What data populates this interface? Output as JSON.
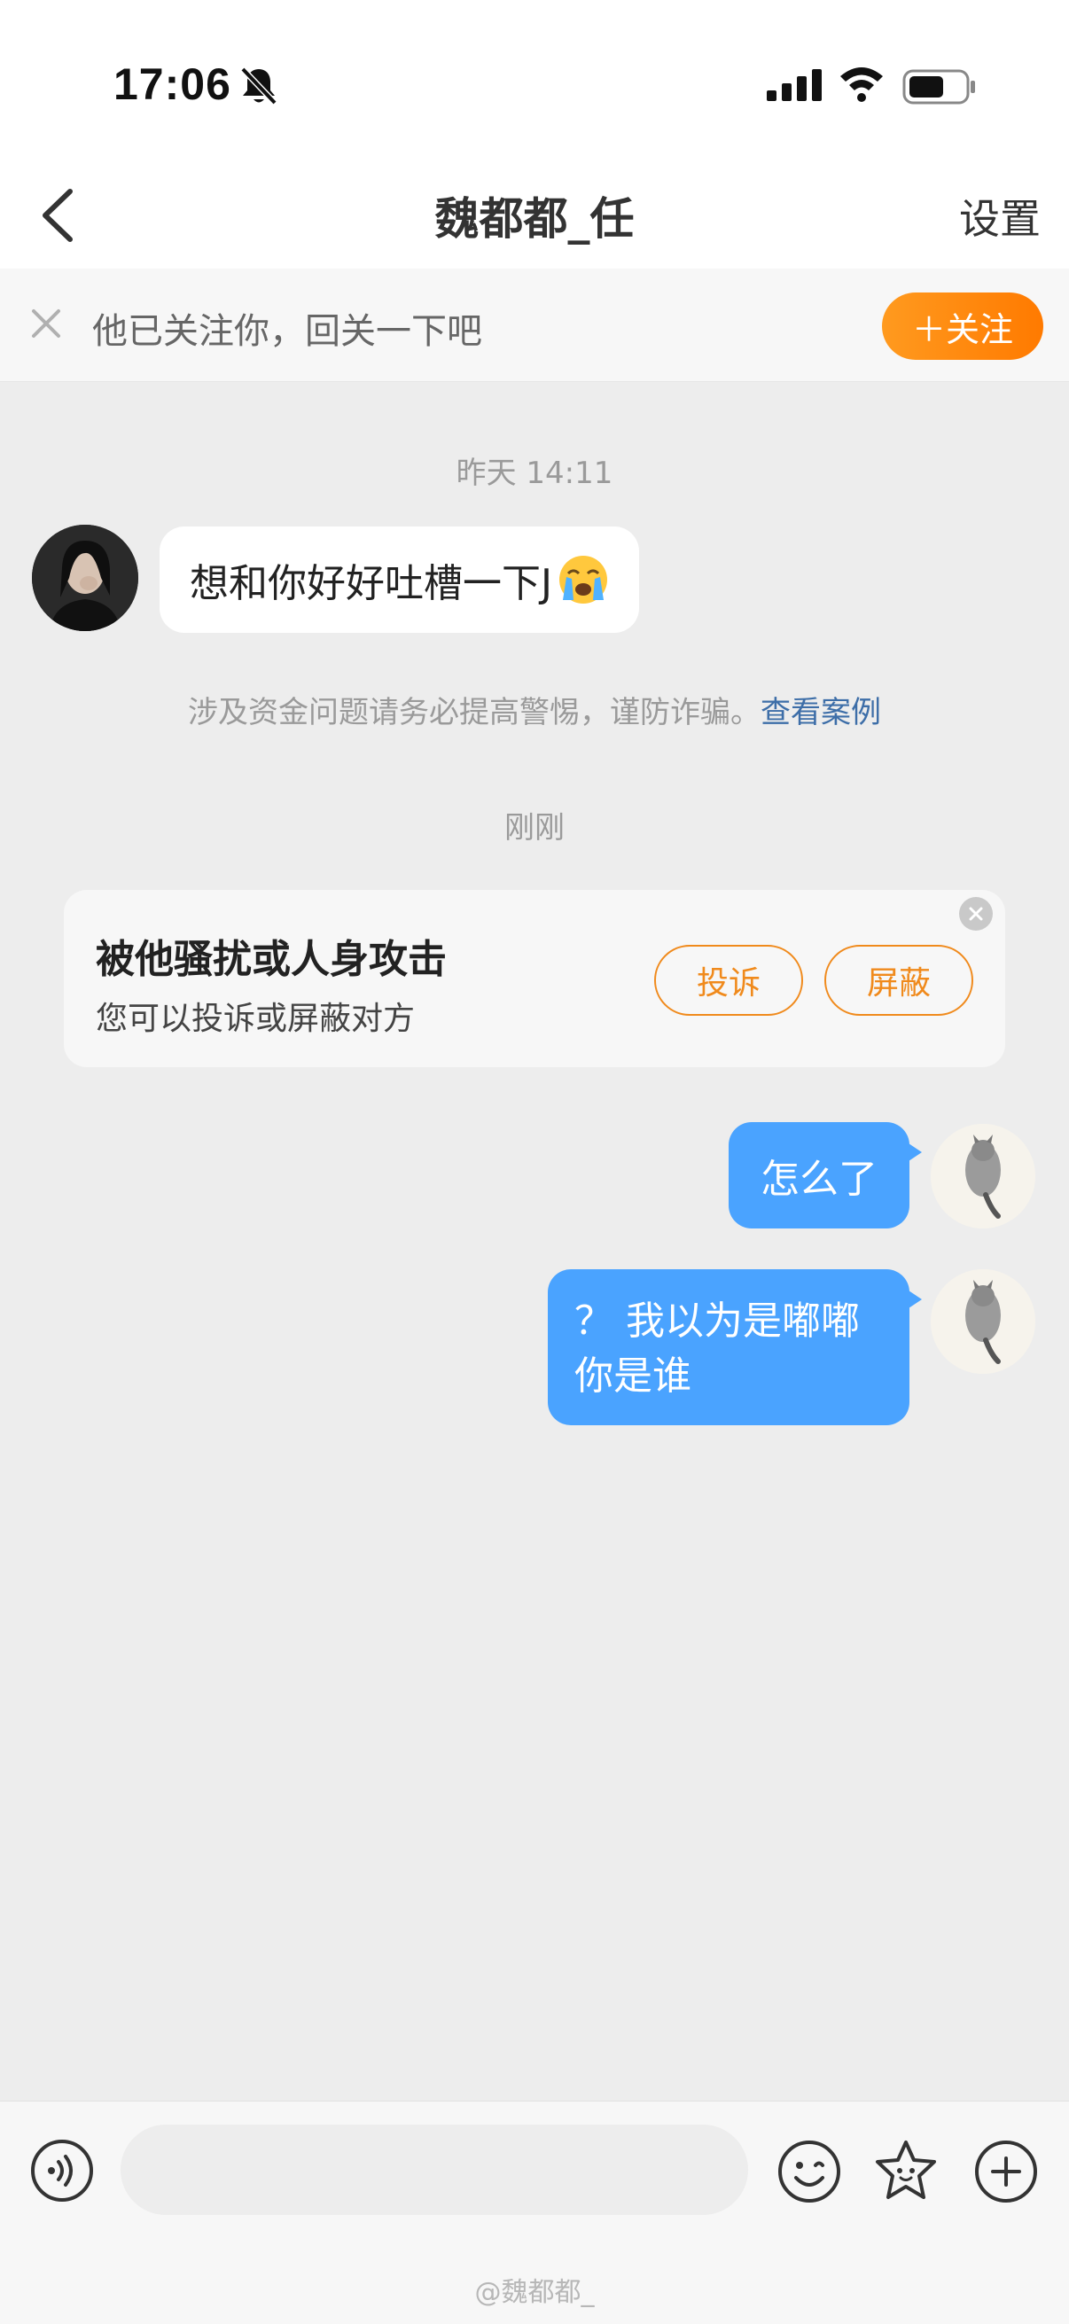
{
  "status_bar": {
    "time": "17:06"
  },
  "nav": {
    "title": "魏都都_任",
    "settings_label": "设置"
  },
  "banner": {
    "text": "他已关注你，回关一下吧",
    "follow_label": "＋关注"
  },
  "chat": {
    "timestamp_1": "昨天 14:11",
    "incoming_message": "想和你好好吐槽一下J",
    "safety_warning": "涉及资金问题请务必提高警惕，谨防诈骗。",
    "safety_link": "查看案例",
    "timestamp_2": "刚刚",
    "harass_card": {
      "title": "被他骚扰或人身攻击",
      "subtitle": "您可以投诉或屏蔽对方",
      "complain_label": "投诉",
      "block_label": "屏蔽"
    },
    "outgoing_1": "怎么了",
    "outgoing_2_line1": "？ 我以为是嘟嘟",
    "outgoing_2_line2": "你是谁"
  },
  "input_bar": {
    "placeholder": ""
  },
  "watermark": "@魏都都_",
  "colors": {
    "accent_orange": "#ff8a00",
    "bubble_blue": "#4aa3ff",
    "link_blue": "#3d6ea8"
  }
}
